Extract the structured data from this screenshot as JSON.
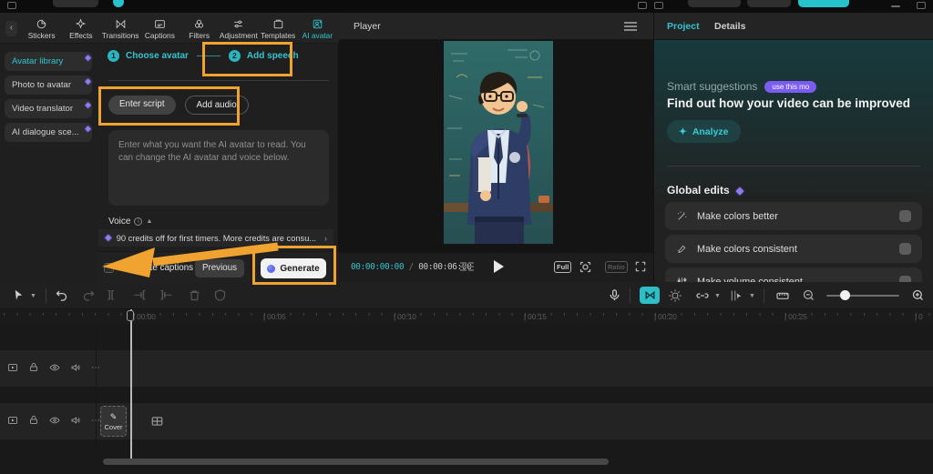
{
  "colors": {
    "accent": "#2fc6d0",
    "annotation": "#f0a330",
    "gem": "#8f7bee",
    "badge_bg": "#7a5cf0"
  },
  "nav": {
    "items": [
      "Stickers",
      "Effects",
      "Transitions",
      "Captions",
      "Filters",
      "Adjustment",
      "Templates",
      "AI avatar"
    ]
  },
  "sidebar": {
    "items": [
      "Avatar library",
      "Photo to avatar",
      "Video translator",
      "AI dialogue sce..."
    ]
  },
  "avatar_panel": {
    "step1_num": "1",
    "step1_label": "Choose avatar",
    "step2_num": "2",
    "step2_label": "Add speech",
    "enter_script": "Enter script",
    "add_audio": "Add audio",
    "script_placeholder": "Enter what you want the AI avatar to read. You can change the AI avatar and voice below.",
    "voice_label": "Voice",
    "credits_banner": "90 credits off for first timers. More credits are consu...",
    "generate_captions": "Generate captions",
    "previous": "Previous",
    "generate": "Generate"
  },
  "player": {
    "title": "Player",
    "current_time": "00:00:00:00",
    "separator": "/",
    "duration": "00:00:06:00",
    "full_label": "Full",
    "ratio_label": "Ratio"
  },
  "inspector": {
    "tab_project": "Project",
    "tab_details": "Details",
    "smart_suggestions": "Smart suggestions",
    "badge": "use this mo",
    "headline": "Find out how your video can be improved",
    "analyze": "Analyze",
    "global_edits": "Global edits",
    "edits": [
      {
        "label": "Make colors better"
      },
      {
        "label": "Make colors consistent"
      },
      {
        "label": "Make volume consistent"
      }
    ]
  },
  "timeline": {
    "ruler_labels": [
      "00:00",
      "00:05",
      "00:10",
      "00:15",
      "00:20",
      "00:25",
      "0"
    ],
    "cover": "Cover"
  }
}
